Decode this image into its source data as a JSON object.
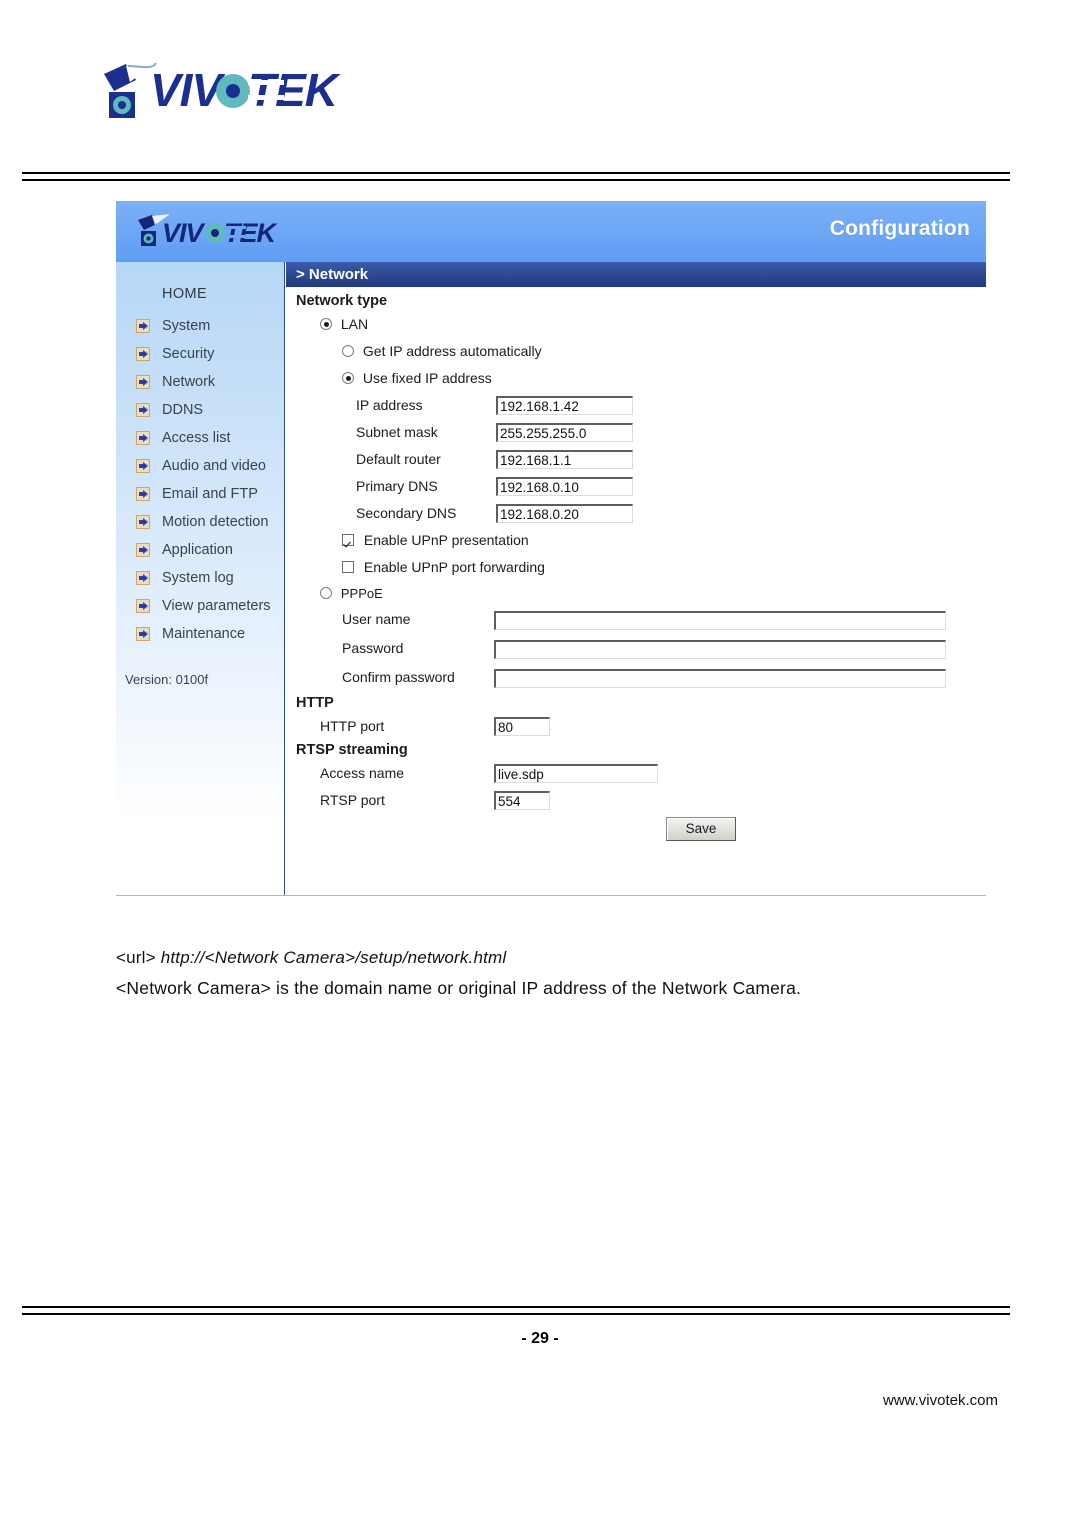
{
  "document": {
    "brand": "VIVOTEK",
    "page_number": "- 29 -",
    "website": "www.vivotek.com",
    "caption_url_tag": "<url>",
    "caption_url_value": "http://<Network Camera>/setup/network.html",
    "caption_note": "<Network Camera> is the domain name or original IP address of the Network Camera."
  },
  "app": {
    "topbar": {
      "logo_alt": "VIVOTEK",
      "title": "Configuration"
    },
    "breadcrumb": "> Network",
    "sidebar": {
      "home_label": "HOME",
      "items": [
        {
          "label": "System"
        },
        {
          "label": "Security"
        },
        {
          "label": "Network"
        },
        {
          "label": "DDNS"
        },
        {
          "label": "Access list"
        },
        {
          "label": "Audio and video"
        },
        {
          "label": "Email and FTP"
        },
        {
          "label": "Motion detection"
        },
        {
          "label": "Application"
        },
        {
          "label": "System log"
        },
        {
          "label": "View parameters"
        },
        {
          "label": "Maintenance"
        }
      ],
      "version": "Version: 0100f"
    },
    "form": {
      "network_type_heading": "Network type",
      "lan_label": "LAN",
      "get_ip_auto_label": "Get IP address automatically",
      "use_fixed_ip_label": "Use fixed IP address",
      "ip_address_label": "IP address",
      "ip_address_value": "192.168.1.42",
      "subnet_mask_label": "Subnet mask",
      "subnet_mask_value": "255.255.255.0",
      "default_router_label": "Default router",
      "default_router_value": "192.168.1.1",
      "primary_dns_label": "Primary DNS",
      "primary_dns_value": "192.168.0.10",
      "secondary_dns_label": "Secondary DNS",
      "secondary_dns_value": "192.168.0.20",
      "upnp_presentation_label": "Enable UPnP presentation",
      "upnp_port_forwarding_label": "Enable UPnP port forwarding",
      "pppoe_label": "PPPoE",
      "user_name_label": "User name",
      "user_name_value": "",
      "password_label": "Password",
      "password_value": "",
      "confirm_password_label": "Confirm password",
      "confirm_password_value": "",
      "http_heading": "HTTP",
      "http_port_label": "HTTP port",
      "http_port_value": "80",
      "rtsp_heading": "RTSP streaming",
      "access_name_label": "Access name",
      "access_name_value": "live.sdp",
      "rtsp_port_label": "RTSP port",
      "rtsp_port_value": "554",
      "save_label": "Save"
    }
  },
  "colors": {
    "topbar_blue": "#69a6f5",
    "breadcrumb_blue": "#2b4c86",
    "sidebar_blue": "#b7d7f7",
    "logo_navy": "#1b2f8f",
    "logo_teal": "#4fb3b8"
  }
}
